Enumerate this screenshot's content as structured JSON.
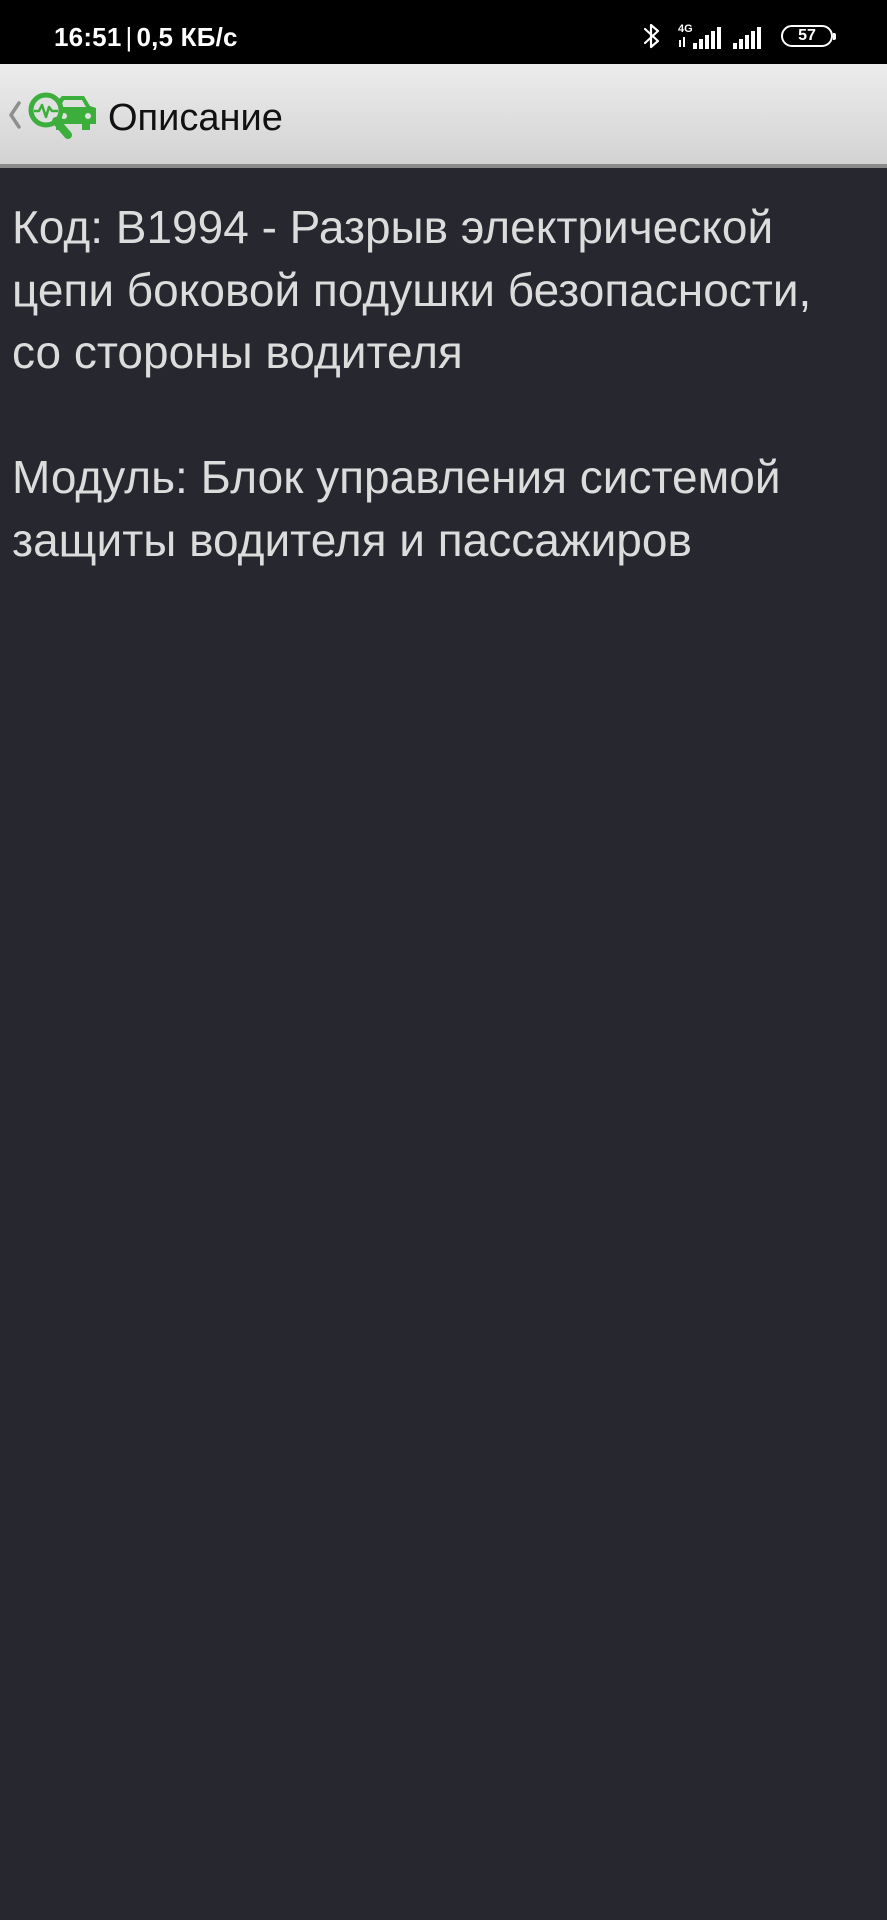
{
  "status_bar": {
    "time": "16:51",
    "separator": "|",
    "network_speed": "0,5 КБ/с",
    "network_type": "4G",
    "battery_level": "57",
    "icons": [
      "bluetooth-icon",
      "signal-4g-icon",
      "signal-icon",
      "battery-icon"
    ]
  },
  "action_bar": {
    "title": "Описание",
    "icon": "car-diagnostics-icon",
    "back_icon": "chevron-left-icon"
  },
  "description": {
    "code_text": "Код: B1994 - Разрыв электрической цепи боковой подушки безопасности, со стороны водителя",
    "module_text": "Модуль: Блок управления системой защиты водителя и пассажиров"
  },
  "colors": {
    "background": "#26272f",
    "text": "#dcdcdc",
    "accent": "#3cae3c",
    "action_bar": "#e0e0e0"
  }
}
